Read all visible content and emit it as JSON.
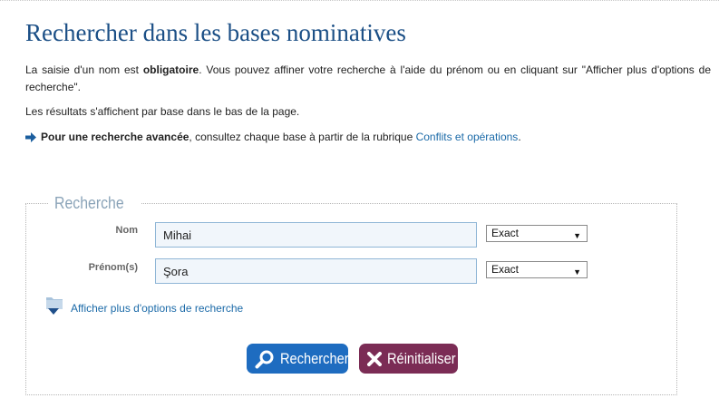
{
  "header": {
    "title": "Rechercher dans les bases nominatives"
  },
  "intro": {
    "p1_before": "La saisie d'un nom est ",
    "p1_bold": "obligatoire",
    "p1_after": ". Vous pouvez affiner votre recherche à l'aide du prénom ou en cliquant sur \"Afficher plus d'options de recherche\".",
    "p2": "Les résultats s'affichent par base dans le bas de la page.",
    "p3_bold": "Pour une recherche avancée",
    "p3_mid": ", consultez chaque base à partir de la rubrique ",
    "p3_link": "Conflits et opérations",
    "p3_end": "."
  },
  "form": {
    "legend": "Recherche",
    "nom_label": "Nom",
    "nom_value": "Mihai",
    "nom_match": "Exact",
    "prenom_label": "Prénom(s)",
    "prenom_value": "Şora",
    "prenom_match": "Exact",
    "more_options": "Afficher plus d'options de recherche",
    "search_button": "Rechercher",
    "reset_button": "Réinitialiser"
  },
  "colors": {
    "title": "#1b4f86",
    "link": "#1b6aa8",
    "search_button": "#1e6cc0",
    "reset_button": "#7b2c55"
  },
  "icons": {
    "arrow": "right-arrow-icon",
    "folder": "folder-expand-icon",
    "search": "search-icon",
    "reset": "close-icon"
  }
}
